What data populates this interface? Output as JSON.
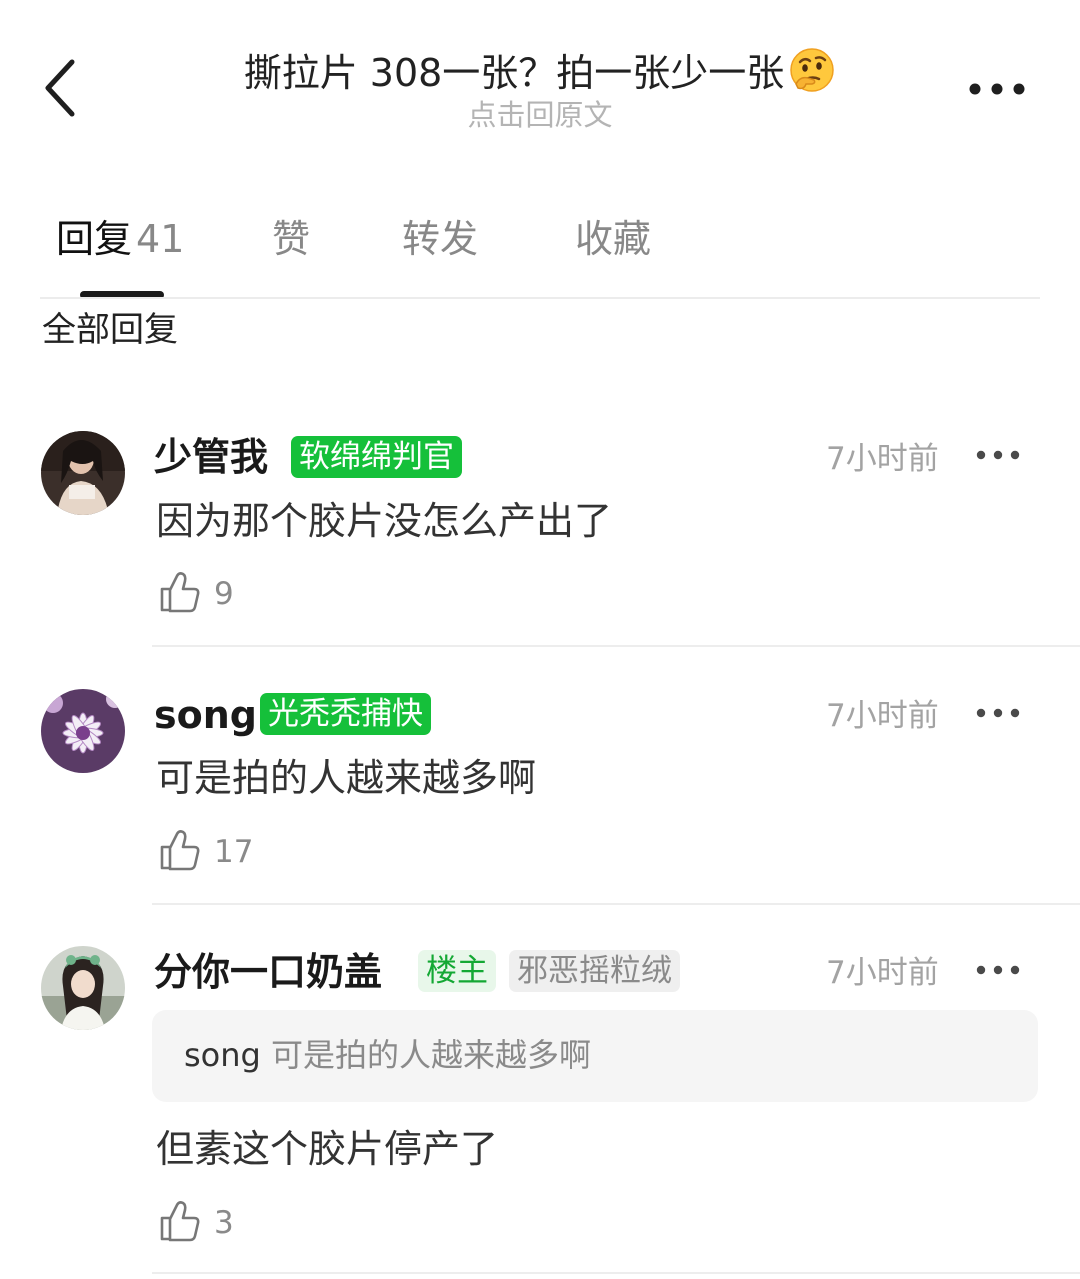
{
  "header": {
    "title": "撕拉片 308一张？拍一张少一张",
    "title_emoji": "thinking-face-emoji",
    "subtitle": "点击回原文"
  },
  "tabs": [
    {
      "label": "回复",
      "count": "41",
      "active": true
    },
    {
      "label": "赞"
    },
    {
      "label": "转发"
    },
    {
      "label": "收藏"
    }
  ],
  "section_title": "全部回复",
  "comments": [
    {
      "username": "少管我",
      "badges": [
        "软绵绵判官"
      ],
      "time": "7小时前",
      "text": "因为那个胶片没怎么产出了",
      "likes": "9"
    },
    {
      "username": "song",
      "badges": [
        "光秃秃捕快"
      ],
      "time": "7小时前",
      "text": "可是拍的人越来越多啊",
      "likes": "17"
    },
    {
      "username": "分你一口奶盖",
      "badges": [
        "楼主",
        "邪恶摇粒绒"
      ],
      "time": "7小时前",
      "quote": {
        "name": "song",
        "text": "可是拍的人越来越多啊"
      },
      "text": "但素这个胶片停产了",
      "likes": "3"
    }
  ],
  "colors": {
    "badge_green": "#15c03a",
    "owner_badge_text": "#14a834",
    "owner_badge_bg": "#e8f7ea",
    "muted_text": "#a3a3a3"
  },
  "icons": [
    "back-chevron-icon",
    "more-dots-icon",
    "thumbs-up-icon"
  ]
}
